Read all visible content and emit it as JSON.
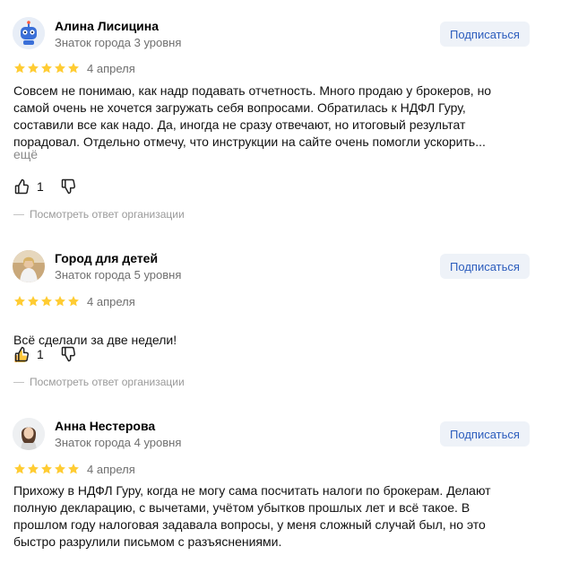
{
  "colors": {
    "star": "#fc3",
    "subscribe_bg": "#eef2f8",
    "subscribe_text": "#2c5dbd",
    "muted": "#6f6f6f"
  },
  "reviews": [
    {
      "author": "Алина Лисицина",
      "level": "Знаток города 3 уровня",
      "subscribe": "Подписаться",
      "stars": 5,
      "date": "4 апреля",
      "text": "Совсем не понимаю, как надр подавать отчетность. Много продаю у брокеров, но\nсамой очень не хочется загружать себя вопросами. Обратилась к НДФЛ Гуру,\nсоставили все как надо. Да, иногда не сразу отвечают, но итоговый результат\nпорадовал. Отдельно отмечу, что инструкции на сайте очень помогли ускорить...",
      "more": "ещё",
      "likes": "1",
      "reply": "Посмотреть ответ организации",
      "avatar_icon": "robot-avatar-icon"
    },
    {
      "author": "Город для детей",
      "level": "Знаток города 5 уровня",
      "subscribe": "Подписаться",
      "stars": 5,
      "date": "4 апреля",
      "text": "Всё сделали за две недели!",
      "likes": "1",
      "reply": "Посмотреть ответ организации",
      "avatar_icon": "person-avatar-icon"
    },
    {
      "author": "Анна Нестерова",
      "level": "Знаток города 4 уровня",
      "subscribe": "Подписаться",
      "stars": 5,
      "date": "4 апреля",
      "text": "Прихожу в НДФЛ Гуру, когда не могу сама посчитать налоги по брокерам. Делают\nполную декларацию, с вычетами, учётом убытков прошлых лет и всё такое. В\nпрошлом году налоговая задавала вопросы, у меня сложный случай был, но это\nбыстро разрулили письмом с разъяснениями.",
      "avatar_icon": "woman-avatar-icon"
    }
  ]
}
